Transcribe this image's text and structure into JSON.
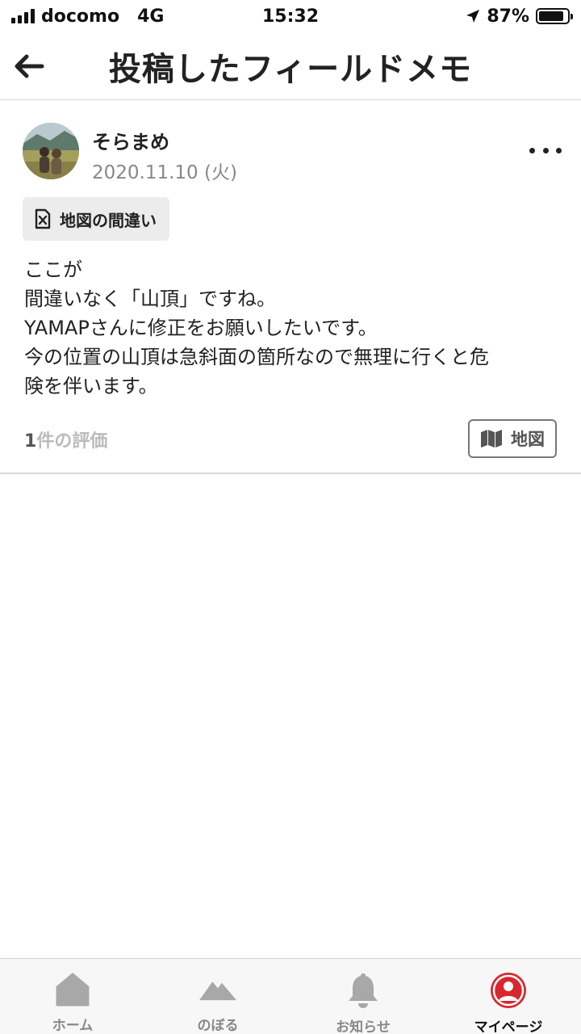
{
  "status_bar": {
    "carrier": "docomo",
    "network": "4G",
    "time": "15:32",
    "battery": "87%",
    "battery_level": 0.87
  },
  "header": {
    "title": "投稿したフィールドメモ",
    "back_icon": "arrow-left-icon"
  },
  "post": {
    "user_name": "そらまめ",
    "date": "2020.11.10 (火)",
    "tag_label": "地図の間違い",
    "body_lines": [
      "ここが",
      "間違いなく「山頂」ですね。",
      "YAMAPさんに修正をお願いしたいです。",
      "今の位置の山頂は急斜面の箇所なので無理に行くと危",
      "険を伴います。"
    ],
    "rating_count": "1",
    "rating_label": "件の評価",
    "map_button_label": "地図"
  },
  "tab_bar": {
    "items": [
      {
        "label": "ホーム",
        "icon": "home-icon",
        "active": false
      },
      {
        "label": "のぼる",
        "icon": "mountain-icon",
        "active": false
      },
      {
        "label": "お知らせ",
        "icon": "bell-icon",
        "active": false
      },
      {
        "label": "マイページ",
        "icon": "user-icon",
        "active": true
      }
    ]
  },
  "colors": {
    "accent_red": "#d7282f",
    "inactive_icon": "#a8a8a8"
  }
}
